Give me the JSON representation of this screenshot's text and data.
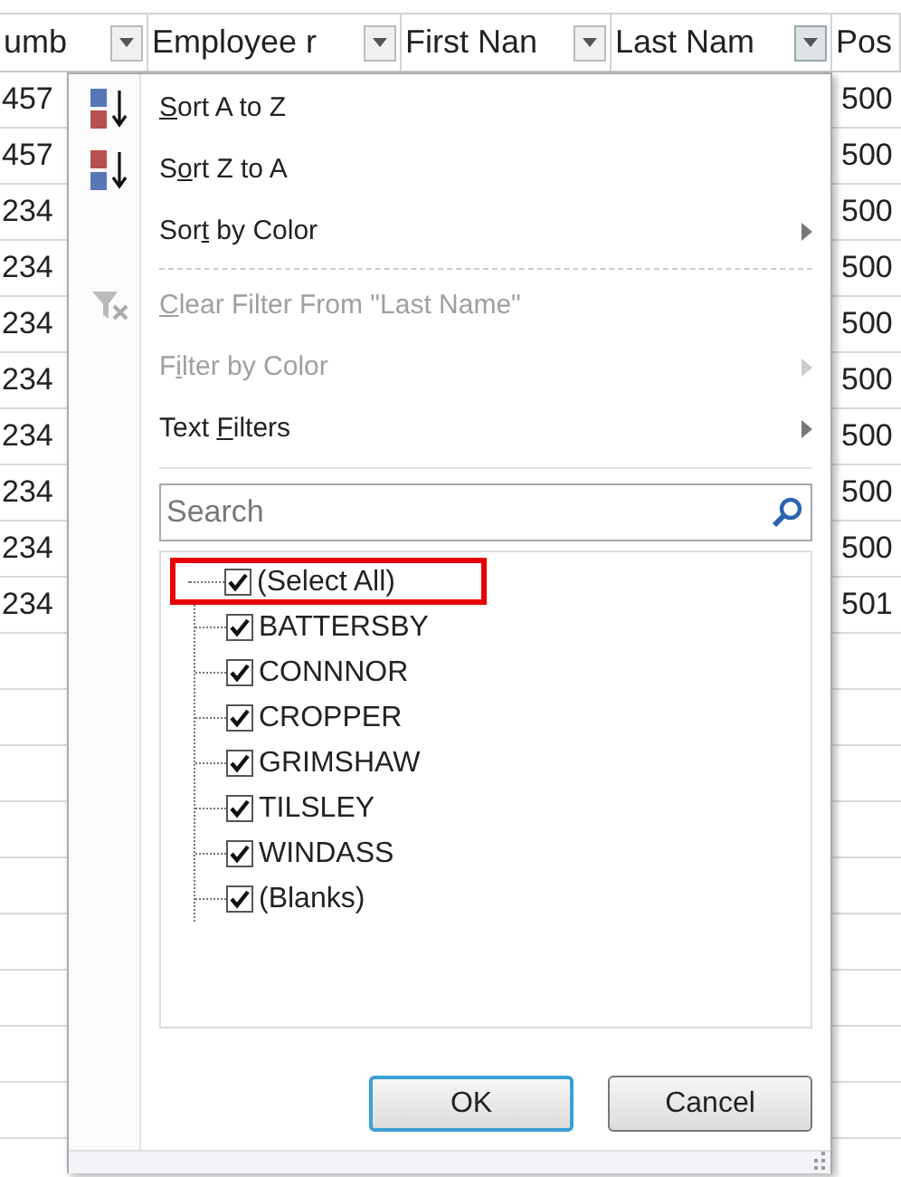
{
  "sheet": {
    "columns": [
      {
        "label": "umb",
        "filter": true
      },
      {
        "label": "Employee r",
        "filter": true
      },
      {
        "label": "First Nan",
        "filter": true
      },
      {
        "label": "Last Nam",
        "filter": true,
        "selected": true
      },
      {
        "label": "Pos",
        "filter": false
      }
    ],
    "left_cells": [
      "457",
      "457",
      "234",
      "234",
      "234",
      "234",
      "234",
      "234",
      "234",
      "234"
    ],
    "right_cells": [
      "500",
      "500",
      "500",
      "500",
      "500",
      "500",
      "500",
      "500",
      "500",
      "501"
    ]
  },
  "menu": {
    "items": [
      {
        "kind": "sort_asc",
        "key": "S",
        "post": "ort A to Z",
        "disabled": false,
        "submenu": false
      },
      {
        "kind": "sort_desc",
        "pre": "S",
        "key": "o",
        "post": "rt Z to A",
        "disabled": false,
        "submenu": false
      },
      {
        "kind": "plain",
        "pre": "Sor",
        "key": "t",
        "post": " by Color",
        "disabled": false,
        "submenu": true
      },
      {
        "kind": "separator"
      },
      {
        "kind": "clear_filter",
        "key": "C",
        "post": "lear Filter From \"Last Name\"",
        "disabled": true,
        "submenu": false
      },
      {
        "kind": "plain",
        "pre": "F",
        "key": "i",
        "post": "lter by Color",
        "disabled": true,
        "submenu": true
      },
      {
        "kind": "plain",
        "pre": "Text ",
        "key": "F",
        "post": "ilters",
        "disabled": false,
        "submenu": true
      }
    ],
    "search": {
      "placeholder": "Search"
    },
    "select_all": {
      "label": "(Select All)",
      "checked": true,
      "highlighted": true
    },
    "values": [
      {
        "label": "BATTERSBY",
        "checked": true
      },
      {
        "label": "CONNNOR",
        "checked": true
      },
      {
        "label": "CROPPER",
        "checked": true
      },
      {
        "label": "GRIMSHAW",
        "checked": true
      },
      {
        "label": "TILSLEY",
        "checked": true
      },
      {
        "label": "WINDASS",
        "checked": true
      },
      {
        "label": "(Blanks)",
        "checked": true
      }
    ],
    "buttons": [
      {
        "label": "OK",
        "default": true
      },
      {
        "label": "Cancel",
        "default": false
      }
    ]
  }
}
